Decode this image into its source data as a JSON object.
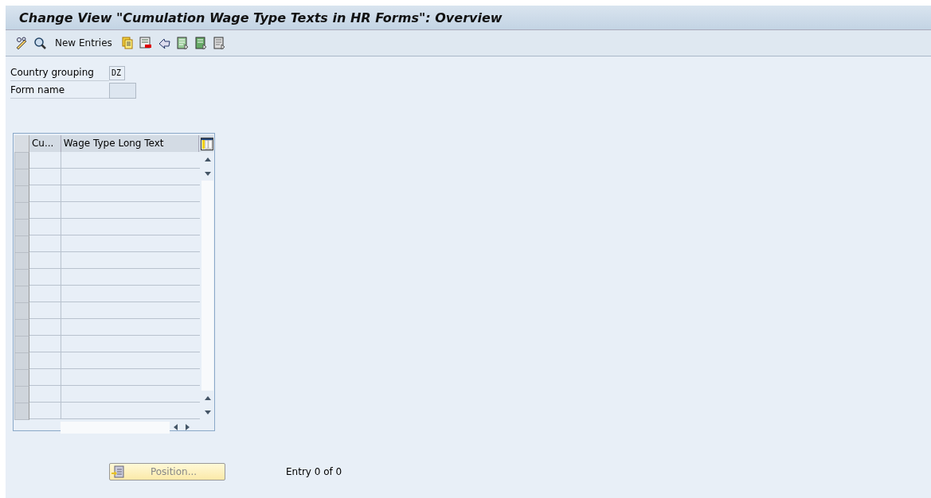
{
  "window": {
    "title": "Change View \"Cumulation Wage Type Texts in HR Forms\": Overview"
  },
  "toolbar": {
    "new_entries": "New Entries"
  },
  "fields": [
    {
      "label": "Country grouping",
      "value": "DZ"
    },
    {
      "label": "Form name"
    }
  ],
  "table": {
    "columns": [
      "Cu...",
      "Wage Type Long Text"
    ]
  },
  "position_button": {
    "label": "Position...",
    "disabled": true
  },
  "entry_info": "Entry 0 of 0"
}
